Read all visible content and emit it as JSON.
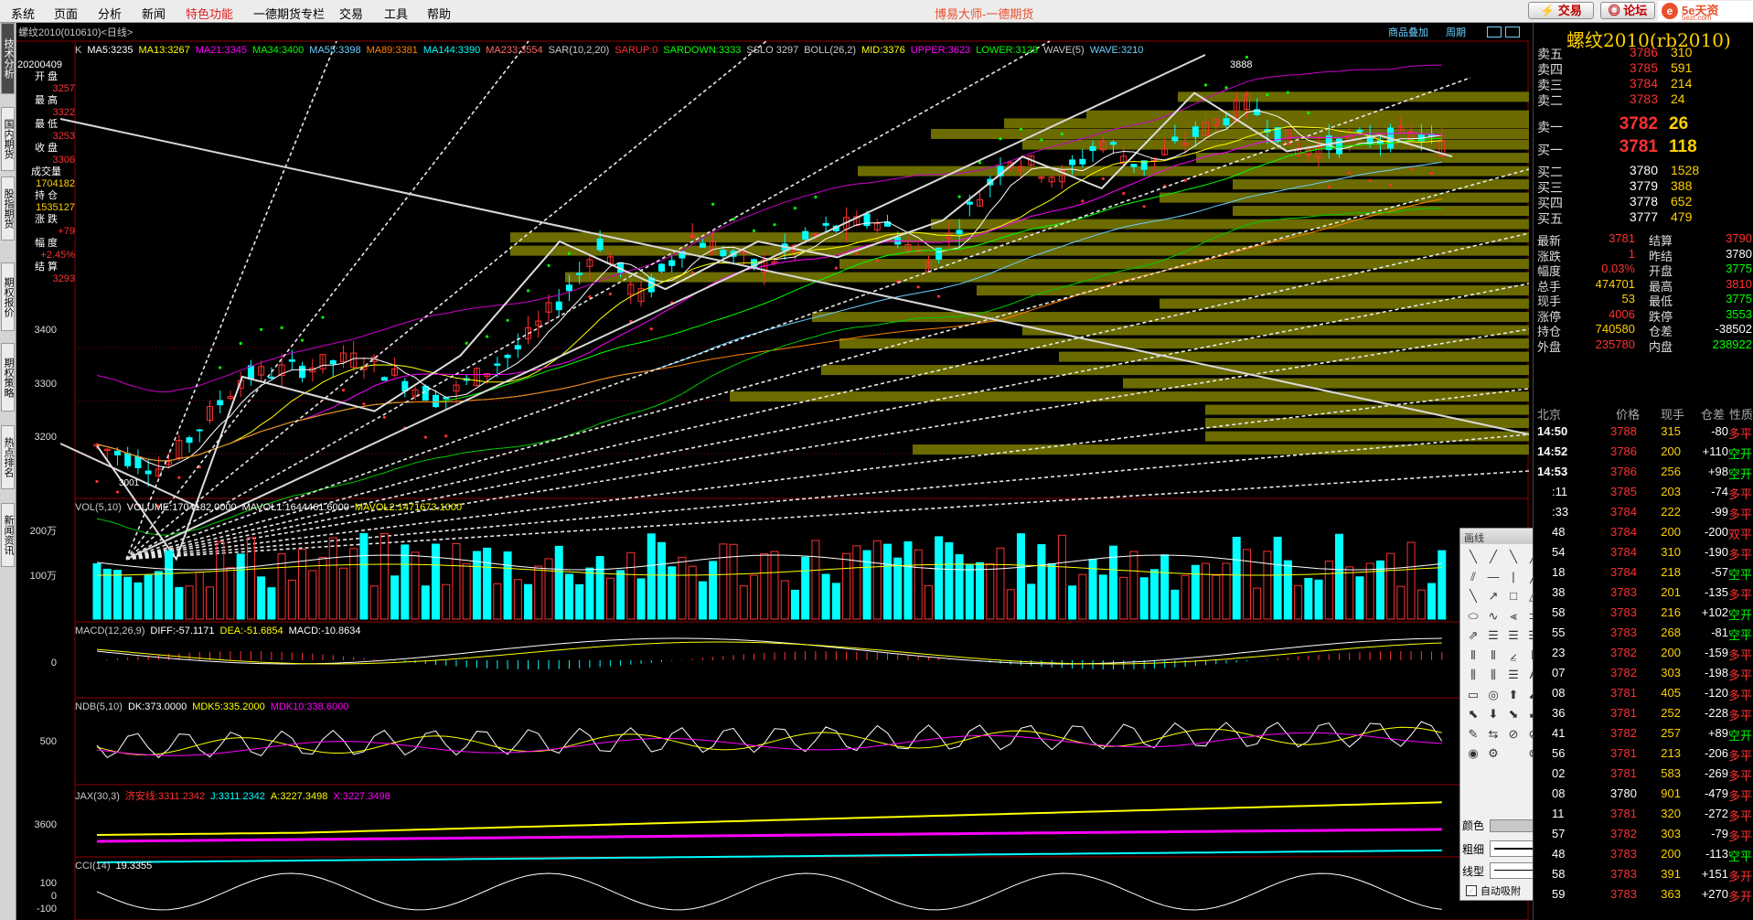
{
  "menu": {
    "items": [
      "系统",
      "页面",
      "分析",
      "新闻",
      "特色功能",
      "一德期货专栏",
      "交易",
      "工具",
      "帮助"
    ],
    "brand": "博易大师-一德期货",
    "btn_trade": "⚡ 交易",
    "btn_forum": "◎ 论坛",
    "logo_name": "5e天资",
    "logo_domain": "5ezt.com"
  },
  "left_tabs": [
    "技术分析",
    "国内期货",
    "股指期货",
    "期权报价",
    "期权策略",
    "热点排名",
    "新闻资讯"
  ],
  "chart": {
    "tab_product": "商品叠加",
    "tab_period": "周期",
    "symbol_line": "螺纹2010(010610)<日线>",
    "ma_line": [
      {
        "t": "K",
        "c": "#c8c8c8"
      },
      {
        "t": "MA5:3235",
        "c": "#ffffff"
      },
      {
        "t": "MA13:3267",
        "c": "#ffff00"
      },
      {
        "t": "MA21:3345",
        "c": "#ff00ff"
      },
      {
        "t": "MA34:3400",
        "c": "#00ff00"
      },
      {
        "t": "MA55:3398",
        "c": "#6ad0ff"
      },
      {
        "t": "MA89:3381",
        "c": "#ff8000"
      },
      {
        "t": "MA144:3390",
        "c": "#00ffff"
      },
      {
        "t": "MA233:3554",
        "c": "#ff6a6a"
      },
      {
        "t": "SAR(10,2,20)",
        "c": "#c8c8c8"
      },
      {
        "t": "SARUP:0",
        "c": "#ff3030"
      },
      {
        "t": "SARDOWN:3333",
        "c": "#00ff00"
      },
      {
        "t": "SSLO 3297",
        "c": "#c8c8c8"
      },
      {
        "t": "BOLL(26,2)",
        "c": "#c8c8c8"
      },
      {
        "t": "MID:3376",
        "c": "#ffff00"
      },
      {
        "t": "UPPER:3623",
        "c": "#ff00ff"
      },
      {
        "t": "LOWER:3129",
        "c": "#00ff00"
      },
      {
        "t": "WAVE(5)",
        "c": "#c8c8c8"
      },
      {
        "t": "WAVE:3210",
        "c": "#6ad0ff"
      }
    ],
    "y_ticks": [
      "3400",
      "3300",
      "3200"
    ],
    "peak_label": "3888",
    "low_label": "3001",
    "info": {
      "date": "20200409",
      "open_label": "开  盘",
      "open": "3257",
      "high_label": "最  高",
      "high": "3322",
      "low_label": "最  低",
      "low": "3253",
      "close_label": "收  盘",
      "close": "3306",
      "vol_label": "成交量",
      "vol": "1704182",
      "oi_label": "持  仓",
      "oi": "1535127",
      "chg_label": "涨  跌",
      "chg": "+79",
      "pct_label": "幅  度",
      "pct": "+2.45%",
      "settle_label": "结  算",
      "settle": "3293"
    },
    "vol_caption": [
      {
        "t": "VOL(5,10)",
        "c": "#c8c8c8"
      },
      {
        "t": "VOLUME:1704182.0000",
        "c": "#ffffff"
      },
      {
        "t": "MAVOL1:1644461.6000",
        "c": "#ffffff"
      },
      {
        "t": "MAVOL2:1471673.1000",
        "c": "#ffff00"
      }
    ],
    "vol_ticks": [
      "200万",
      "100万"
    ],
    "macd_caption": [
      {
        "t": "MACD(12,26,9)",
        "c": "#c8c8c8"
      },
      {
        "t": "DIFF:-57.1171",
        "c": "#ffffff"
      },
      {
        "t": "DEA:-51.6854",
        "c": "#ffff00"
      },
      {
        "t": "MACD:-10.8634",
        "c": "#ffffff"
      }
    ],
    "macd_ticks": [
      "0"
    ],
    "ndb_caption": [
      {
        "t": "NDB(5,10)",
        "c": "#c8c8c8"
      },
      {
        "t": "DK:373.0000",
        "c": "#ffffff"
      },
      {
        "t": "MDK5:335.2000",
        "c": "#ffff00"
      },
      {
        "t": "MDK10:338.6000",
        "c": "#ff00ff"
      }
    ],
    "ndb_ticks": [
      "500"
    ],
    "jax_caption": [
      {
        "t": "JAX(30,3)",
        "c": "#c8c8c8"
      },
      {
        "t": "济安线:3311.2342",
        "c": "#ff3030"
      },
      {
        "t": "J:3311.2342",
        "c": "#00ffff"
      },
      {
        "t": "A:3227.3498",
        "c": "#ffff00"
      },
      {
        "t": "X:3227.3498",
        "c": "#ff00ff"
      }
    ],
    "jax_ticks": [
      "3600"
    ],
    "cci_caption": [
      {
        "t": "CCI(14)",
        "c": "#c8c8c8"
      },
      {
        "t": "19.3355",
        "c": "#ffffff"
      }
    ],
    "cci_ticks": [
      "100",
      "0",
      "-100"
    ]
  },
  "right": {
    "title": "螺纹2010(rb2010)",
    "asks": [
      {
        "label": "卖五",
        "price": "3786",
        "vol": "310"
      },
      {
        "label": "卖四",
        "price": "3785",
        "vol": "591"
      },
      {
        "label": "卖三",
        "price": "3784",
        "vol": "214"
      },
      {
        "label": "卖二",
        "price": "3783",
        "vol": "24"
      }
    ],
    "ask1": {
      "label": "卖一",
      "price": "3782",
      "vol": "26"
    },
    "bid1": {
      "label": "买一",
      "price": "3781",
      "vol": "118"
    },
    "bids": [
      {
        "label": "买二",
        "price": "3780",
        "vol": "1528"
      },
      {
        "label": "买三",
        "price": "3779",
        "vol": "388"
      },
      {
        "label": "买四",
        "price": "3778",
        "vol": "652"
      },
      {
        "label": "买五",
        "price": "3777",
        "vol": "479"
      }
    ],
    "quote": [
      {
        "l1": "最新",
        "v1": "3781",
        "c1": "#ff3030",
        "l2": "结算",
        "v2": "3790",
        "c2": "#ff3030"
      },
      {
        "l1": "涨跌",
        "v1": "1",
        "c1": "#ff3030",
        "l2": "昨结",
        "v2": "3780",
        "c2": "#ffffff"
      },
      {
        "l1": "幅度",
        "v1": "0.03%",
        "c1": "#ff3030",
        "l2": "开盘",
        "v2": "3775",
        "c2": "#00ff00"
      },
      {
        "l1": "总手",
        "v1": "474701",
        "c1": "#ffd000",
        "l2": "最高",
        "v2": "3810",
        "c2": "#ff3030"
      },
      {
        "l1": "现手",
        "v1": "53",
        "c1": "#ffd000",
        "l2": "最低",
        "v2": "3775",
        "c2": "#00ff00"
      },
      {
        "l1": "涨停",
        "v1": "4006",
        "c1": "#ff3030",
        "l2": "跌停",
        "v2": "3553",
        "c2": "#00ff00"
      },
      {
        "l1": "持仓",
        "v1": "740580",
        "c1": "#ffd000",
        "l2": "仓差",
        "v2": "-38502",
        "c2": "#ffffff"
      },
      {
        "l1": "外盘",
        "v1": "235780",
        "c1": "#ff3030",
        "l2": "内盘",
        "v2": "238922",
        "c2": "#00ff00"
      }
    ],
    "trades_header": {
      "city": "北京",
      "price": "价格",
      "vol": "现手",
      "diff": "仓差",
      "kind": "性质"
    },
    "trades": [
      {
        "time": "14:50",
        "price": "3788",
        "vol": "315",
        "diff": "-80",
        "kind": "多平",
        "pc": "#ff3030",
        "kc": "#ff3030"
      },
      {
        "time": "14:52",
        "price": "3786",
        "vol": "200",
        "diff": "+110",
        "kind": "空开",
        "pc": "#ff3030",
        "kc": "#00ff00"
      },
      {
        "time": "14:53",
        "price": "3786",
        "vol": "256",
        "diff": "+98",
        "kind": "空开",
        "pc": "#ff3030",
        "kc": "#00ff00"
      },
      {
        "time": ":11",
        "price": "3785",
        "vol": "203",
        "diff": "-74",
        "kind": "多平",
        "pc": "#ff3030",
        "kc": "#ff3030"
      },
      {
        "time": ":33",
        "price": "3784",
        "vol": "222",
        "diff": "-99",
        "kind": "多平",
        "pc": "#ff3030",
        "kc": "#ff3030"
      },
      {
        "time": "48",
        "price": "3784",
        "vol": "200",
        "diff": "-200",
        "kind": "双平",
        "pc": "#ff3030",
        "kc": "#ff3030"
      },
      {
        "time": "54",
        "price": "3784",
        "vol": "310",
        "diff": "-190",
        "kind": "多平",
        "pc": "#ff3030",
        "kc": "#ff3030"
      },
      {
        "time": "18",
        "price": "3784",
        "vol": "218",
        "diff": "-57",
        "kind": "空平",
        "pc": "#ff3030",
        "kc": "#00ff00"
      },
      {
        "time": "38",
        "price": "3783",
        "vol": "201",
        "diff": "-135",
        "kind": "多平",
        "pc": "#ff3030",
        "kc": "#ff3030"
      },
      {
        "time": "58",
        "price": "3783",
        "vol": "216",
        "diff": "+102",
        "kind": "空开",
        "pc": "#ff3030",
        "kc": "#00ff00"
      },
      {
        "time": "55",
        "price": "3783",
        "vol": "268",
        "diff": "-81",
        "kind": "空平",
        "pc": "#ff3030",
        "kc": "#00ff00"
      },
      {
        "time": "23",
        "price": "3782",
        "vol": "200",
        "diff": "-159",
        "kind": "多平",
        "pc": "#ff3030",
        "kc": "#ff3030"
      },
      {
        "time": "07",
        "price": "3782",
        "vol": "303",
        "diff": "-198",
        "kind": "多平",
        "pc": "#ff3030",
        "kc": "#ff3030"
      },
      {
        "time": "08",
        "price": "3781",
        "vol": "405",
        "diff": "-120",
        "kind": "多平",
        "pc": "#ff3030",
        "kc": "#ff3030"
      },
      {
        "time": "36",
        "price": "3781",
        "vol": "252",
        "diff": "-228",
        "kind": "多平",
        "pc": "#ff3030",
        "kc": "#ff3030"
      },
      {
        "time": "41",
        "price": "3782",
        "vol": "257",
        "diff": "+89",
        "kind": "空开",
        "pc": "#ff3030",
        "kc": "#00ff00"
      },
      {
        "time": "56",
        "price": "3781",
        "vol": "213",
        "diff": "-206",
        "kind": "多平",
        "pc": "#ff3030",
        "kc": "#ff3030"
      },
      {
        "time": "02",
        "price": "3781",
        "vol": "583",
        "diff": "-269",
        "kind": "多平",
        "pc": "#ff3030",
        "kc": "#ff3030"
      },
      {
        "time": "08",
        "price": "3780",
        "vol": "901",
        "diff": "-479",
        "kind": "多平",
        "pc": "#ffffff",
        "kc": "#ff3030"
      },
      {
        "time": "11",
        "price": "3781",
        "vol": "320",
        "diff": "-272",
        "kind": "多平",
        "pc": "#ff3030",
        "kc": "#ff3030"
      },
      {
        "time": "57",
        "price": "3782",
        "vol": "303",
        "diff": "-79",
        "kind": "多平",
        "pc": "#ff3030",
        "kc": "#ff3030"
      },
      {
        "time": "48",
        "price": "3783",
        "vol": "200",
        "diff": "-113",
        "kind": "空平",
        "pc": "#ff3030",
        "kc": "#00ff00"
      },
      {
        "time": "58",
        "price": "3783",
        "vol": "391",
        "diff": "+151",
        "kind": "多开",
        "pc": "#ff3030",
        "kc": "#ff3030"
      },
      {
        "time": "59",
        "price": "3783",
        "vol": "363",
        "diff": "+270",
        "kind": "多开",
        "pc": "#ff3030",
        "kc": "#ff3030"
      }
    ]
  },
  "toolbox": {
    "title": "画线",
    "close": "×",
    "color_label": "颜色",
    "width_label": "粗细",
    "style_label": "线型",
    "auto_attach": "自动吸附",
    "tools": [
      "╲",
      "╱",
      "╲",
      "╱",
      "⫽",
      "—",
      "|",
      "╱",
      "╲",
      "↗",
      "□",
      "△",
      "⬭",
      "∿",
      "⫷",
      "⊃",
      "⇗",
      "☰",
      "☰",
      "☰",
      "⦀",
      "⦀",
      "⦤",
      "⦀",
      "⫼",
      "⫼",
      "☰",
      "A",
      "▭",
      "◎",
      "⬆",
      "⬈",
      "⬉",
      "⬇",
      "⬊",
      "⬋",
      "✎",
      "⇆",
      "⊘",
      "⊘",
      "◉",
      "⚙",
      "",
      "⊗"
    ]
  },
  "colors": {
    "up": "#ff3030",
    "down": "#00ffff",
    "volume_zone": "#6b6b00",
    "grid": "#8b0000"
  }
}
